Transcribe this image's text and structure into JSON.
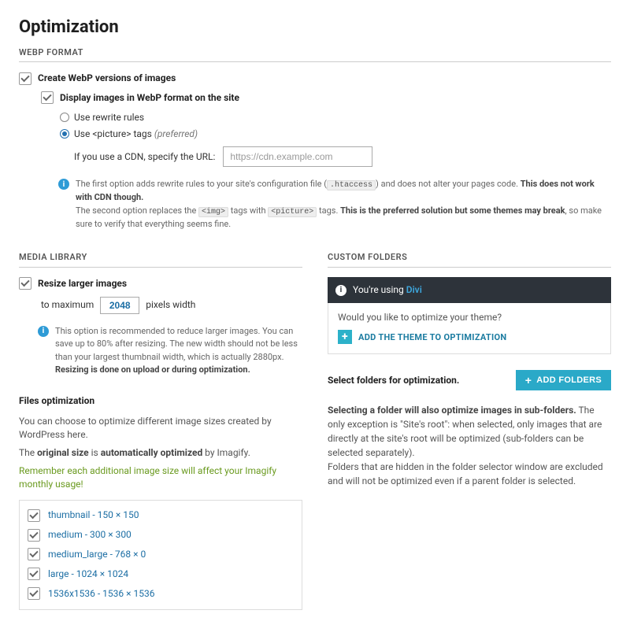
{
  "page": {
    "title": "Optimization"
  },
  "webp": {
    "section_title": "WEBP FORMAT",
    "create_label": "Create WebP versions of images",
    "display_label": "Display images in WebP format on the site",
    "radio_rewrite": "Use rewrite rules",
    "radio_picture_prefix": "Use ",
    "radio_picture_code": "<picture>",
    "radio_picture_suffix": " tags ",
    "radio_picture_preferred": "(preferred)",
    "cdn_label": "If you use a CDN, specify the URL:",
    "cdn_placeholder": "https://cdn.example.com",
    "info_line1_a": "The first option adds rewrite rules to your site's configuration file (",
    "info_code_htaccess": ".htaccess",
    "info_line1_b": ") and does not alter your pages code. ",
    "info_line1_strong": "This does not work with CDN though.",
    "info_line2_a": "The second option replaces the ",
    "info_code_img": "<img>",
    "info_line2_b": " tags with ",
    "info_code_picture": "<picture>",
    "info_line2_c": " tags. ",
    "info_line2_strong": "This is the preferred solution but some themes may break",
    "info_line2_d": ", so make sure to verify that everything seems fine."
  },
  "media": {
    "section_title": "MEDIA LIBRARY",
    "resize_label": "Resize larger images",
    "to_max": "to maximum",
    "px_width": "pixels width",
    "width_value": "2048",
    "info": "This option is recommended to reduce larger images. You can save up to 80% after resizing. The new width should not be less than your largest thumbnail width, which is actually 2880px. ",
    "info_strong": "Resizing is done on upload or during optimization.",
    "files_title": "Files optimization",
    "files_help1": "You can choose to optimize different image sizes created by WordPress here.",
    "files_help2a": "The ",
    "files_help2b": "original size",
    "files_help2c": " is ",
    "files_help2d": "automatically optimized",
    "files_help2e": " by Imagify.",
    "files_help3": "Remember each additional image size will affect your Imagify monthly usage!",
    "sizes": [
      "thumbnail - 150 × 150",
      "medium - 300 × 300",
      "medium_large - 768 × 0",
      "large - 1024 × 1024",
      "1536x1536 - 1536 × 1536"
    ]
  },
  "custom": {
    "section_title": "CUSTOM FOLDERS",
    "youre_using": "You're using ",
    "theme": "Divi",
    "optimize_theme_q": "Would you like to optimize your theme?",
    "add_theme_label": "ADD THE THEME TO OPTIMIZATION",
    "select_folders_label": "Select folders for optimization.",
    "add_folders_btn": "ADD FOLDERS",
    "help1_strong": "Selecting a folder will also optimize images in sub-folders.",
    "help1_rest": " The only exception is \"Site's root\": when selected, only images that are directly at the site's root will be optimized (sub-folders can be selected separately).",
    "help2": "Folders that are hidden in the folder selector window are excluded and will not be optimized even if a parent folder is selected."
  }
}
